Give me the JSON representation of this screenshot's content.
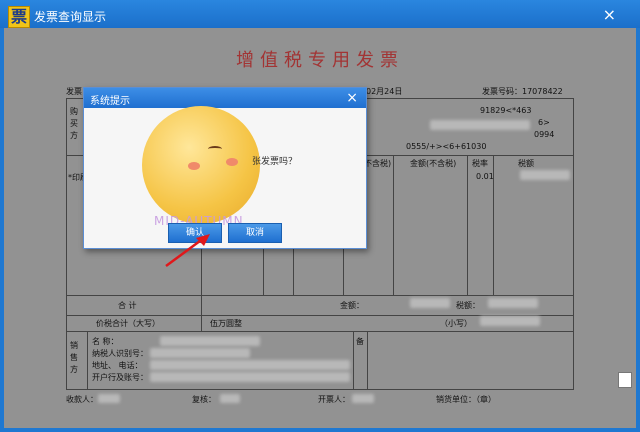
{
  "window": {
    "app_icon_char": "票",
    "title": "发票查询显示",
    "close_glyph": "×"
  },
  "invoice": {
    "title": "增值税专用发票",
    "label_invoice_code": "发票",
    "date_fragment": "02月24日",
    "invoice_number": "发票号码：17078422",
    "buyer_side": [
      "购",
      "买",
      "方"
    ],
    "cipher_lines": [
      "91829<*463",
      "6>",
      "0994",
      "0555/+><6+61030"
    ],
    "goods_col": "*印刷",
    "col_untaxed": "不含税)",
    "col_amount": "金额(不含税)",
    "col_rate": "税率",
    "col_tax": "税额",
    "rate_value": "0.01",
    "total_label": "合 计",
    "amount_label": "金额：",
    "tax_label": "税额：",
    "total_in_words_label": "价税合计（大写）",
    "total_in_words_value": "伍万圆整",
    "small_label": "（小写）",
    "seller_side": [
      "销",
      "售",
      "方"
    ],
    "seller_name": "名    称：",
    "seller_tax_id": "纳税人识别号：",
    "seller_address": "地址、  电话：",
    "seller_bank": "开户行及账号：",
    "remark": "备",
    "payee": "收款人：",
    "reviewer": "复核：",
    "issuer": "开票人：",
    "seller_unit": "销货单位：（章）"
  },
  "dialog": {
    "title": "系统提示",
    "message": "张发票吗？",
    "confirm_label": "确认",
    "cancel_label": "取消",
    "close_glyph": "×",
    "watermark": "MID-AUTUMN"
  },
  "colors": {
    "title_bar": "#1f78d1",
    "invoice_title": "#a23434",
    "arrow": "#e0181b"
  }
}
